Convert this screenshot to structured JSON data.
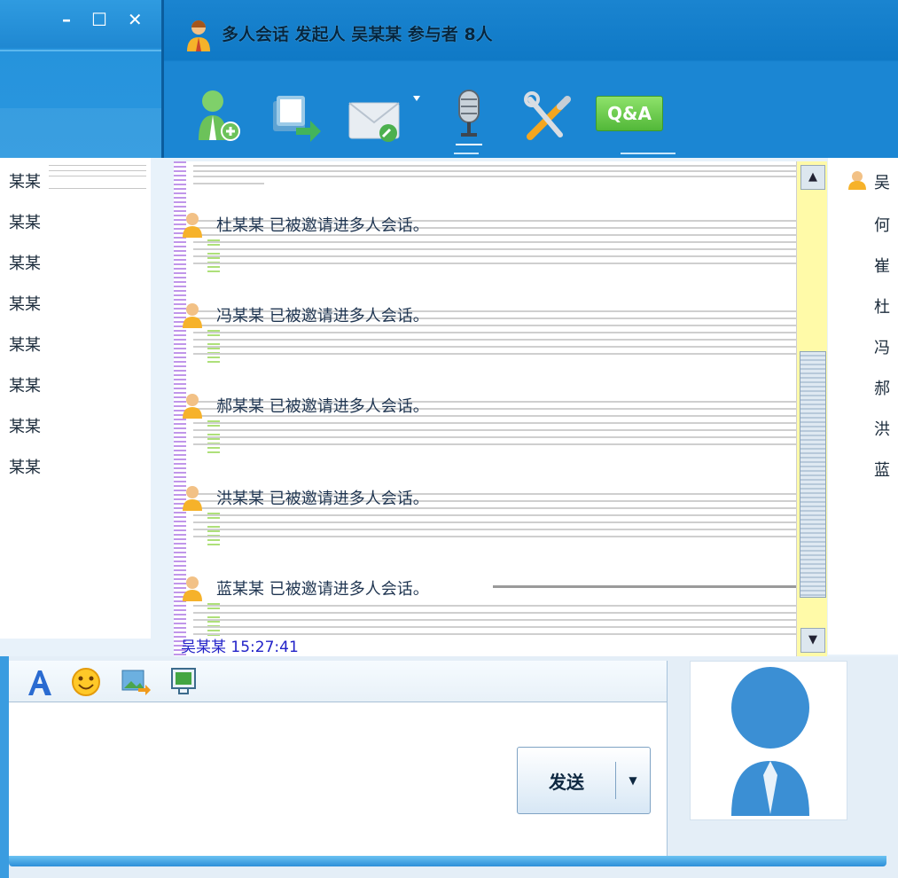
{
  "back_window": {
    "controls": "– ☐ ✕",
    "list_items": [
      "某某",
      "某某",
      "某某",
      "某某",
      "某某",
      "某某",
      "某某",
      "某某"
    ]
  },
  "main_window": {
    "title": "多人会话  发起人  吴某某  参与者  8人",
    "toolbar": {
      "items": [
        "add-participant-icon",
        "send-file-icon",
        "message-icon",
        "microphone-icon",
        "settings-icon",
        "qa-icon"
      ],
      "qa_label": "Q&A"
    }
  },
  "chat": {
    "messages": [
      {
        "text": "杜某某  已被邀请进多人会话。"
      },
      {
        "text": "冯某某  已被邀请进多人会话。"
      },
      {
        "text": "郝某某  已被邀请进多人会话。"
      },
      {
        "text": "洪某某  已被邀请进多人会话。"
      },
      {
        "text": "蓝某某  已被邀请进多人会话。"
      }
    ],
    "timestamp": "吴某某  15:27:41"
  },
  "participants": {
    "first": "吴",
    "others": [
      "何",
      "崔",
      "杜",
      "冯",
      "郝",
      "洪",
      "蓝"
    ]
  },
  "input": {
    "send_label": "发送",
    "format_icons": [
      "font-icon",
      "emoji-icon",
      "image-icon",
      "screenshot-icon"
    ]
  },
  "colors": {
    "title_bar": "#1b86d3",
    "scroll_track": "#fffaa8",
    "chat_bg": "#ffffff"
  }
}
